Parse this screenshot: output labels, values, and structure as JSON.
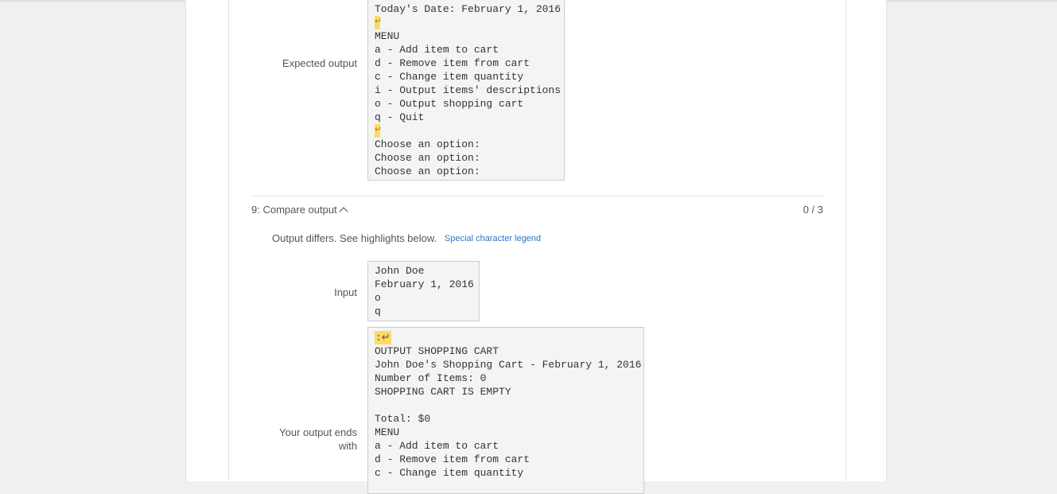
{
  "expected": {
    "label": "Expected output",
    "lines": [
      {
        "text": "Today's Date: February 1, 2016"
      },
      {
        "text": "",
        "newline": true
      },
      {
        "text": "MENU"
      },
      {
        "text": "a - Add item to cart"
      },
      {
        "text": "d - Remove item from cart"
      },
      {
        "text": "c - Change item quantity"
      },
      {
        "text": "i - Output items' descriptions"
      },
      {
        "text": "o - Output shopping cart"
      },
      {
        "text": "q - Quit"
      },
      {
        "text": "",
        "newline": true
      },
      {
        "text": "Choose an option:"
      },
      {
        "text": "Choose an option:"
      },
      {
        "text": "Choose an option:"
      }
    ]
  },
  "test": {
    "title": "9: Compare output",
    "score": "0 / 3",
    "diff_message": "Output differs. See highlights below.",
    "legend_link": "Special character legend"
  },
  "input": {
    "label": "Input",
    "lines": [
      "John Doe",
      "February 1, 2016",
      "o",
      "q"
    ]
  },
  "yours": {
    "label_line1": "Your output ends",
    "label_line2": "with",
    "first_line_highlight": ":↵",
    "lines": [
      "OUTPUT SHOPPING CART",
      "John Doe's Shopping Cart - February 1, 2016",
      "Number of Items: 0",
      "SHOPPING CART IS EMPTY",
      "",
      "Total: $0",
      "MENU",
      "a - Add item to cart",
      "d - Remove item from cart",
      "c - Change item quantity"
    ]
  },
  "newline_glyph": "↵"
}
